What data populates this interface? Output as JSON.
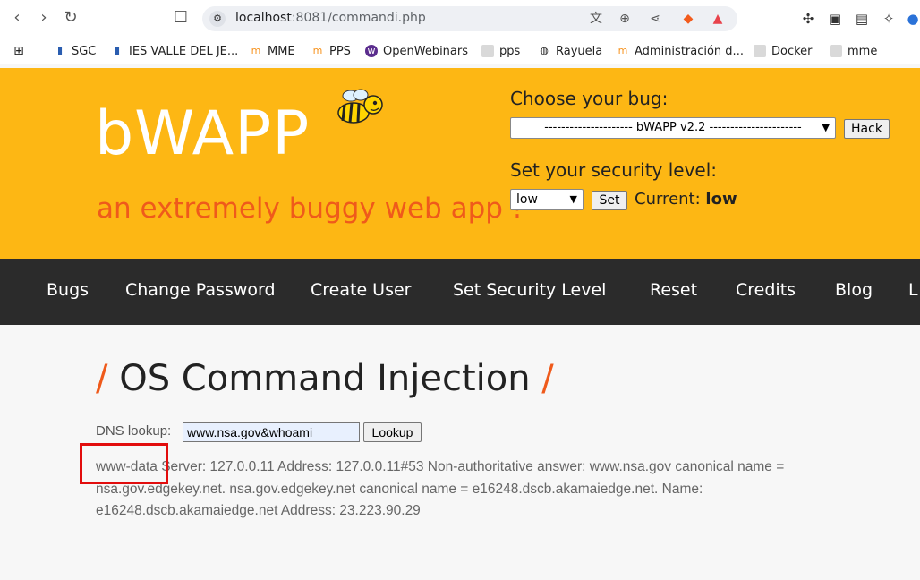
{
  "browser": {
    "url_host": "localhost",
    "url_path": ":8081/commandi.php",
    "bookmarks": [
      {
        "label": "SGC",
        "icon": "sgc-icon",
        "color": "#2a5db0"
      },
      {
        "label": "IES VALLE DEL JE...",
        "icon": "ies-icon",
        "color": "#2a5db0"
      },
      {
        "label": "MME",
        "icon": "moodle-icon",
        "color": "#f7931e"
      },
      {
        "label": "PPS",
        "icon": "moodle-icon",
        "color": "#f7931e"
      },
      {
        "label": "OpenWebinars",
        "icon": "openwebinars-icon",
        "color": "#5b2d8e"
      },
      {
        "label": "pps",
        "icon": "folder-icon",
        "color": "#d9d9d9"
      },
      {
        "label": "Rayuela",
        "icon": "globe-icon",
        "color": "#333333"
      },
      {
        "label": "Administración d...",
        "icon": "moodle-icon",
        "color": "#f7931e"
      },
      {
        "label": "Docker",
        "icon": "folder-icon",
        "color": "#d9d9d9"
      },
      {
        "label": "mme",
        "icon": "folder-icon",
        "color": "#d9d9d9"
      }
    ]
  },
  "header": {
    "logo": "bWAPP",
    "tagline": "an extremely buggy web app !",
    "choose_label": "Choose your bug:",
    "bug_selected": "--------------------- bWAPP v2.2 ----------------------",
    "hack_button": "Hack",
    "security_label": "Set your security level:",
    "security_selected": "low",
    "set_button": "Set",
    "current_label": "Current:",
    "current_value": "low"
  },
  "menu": {
    "items": [
      "Bugs",
      "Change Password",
      "Create User",
      "Set Security Level",
      "Reset",
      "Credits",
      "Blog",
      "L"
    ]
  },
  "main": {
    "title": "OS Command Injection",
    "dns_label": "DNS lookup:",
    "dns_value": "www.nsa.gov&whoami",
    "lookup_button": "Lookup",
    "output": "www-data Server: 127.0.0.11 Address: 127.0.0.11#53 Non-authoritative answer: www.nsa.gov canonical name = nsa.gov.edgekey.net. nsa.gov.edgekey.net canonical name = e16248.dscb.akamaiedge.net. Name: e16248.dscb.akamaiedge.net Address: 23.223.90.29"
  },
  "colors": {
    "header_bg": "#fdb714",
    "accent_orange": "#ef5a1b",
    "menu_bg": "#2b2b2b",
    "highlight_red": "#e20d0d"
  }
}
